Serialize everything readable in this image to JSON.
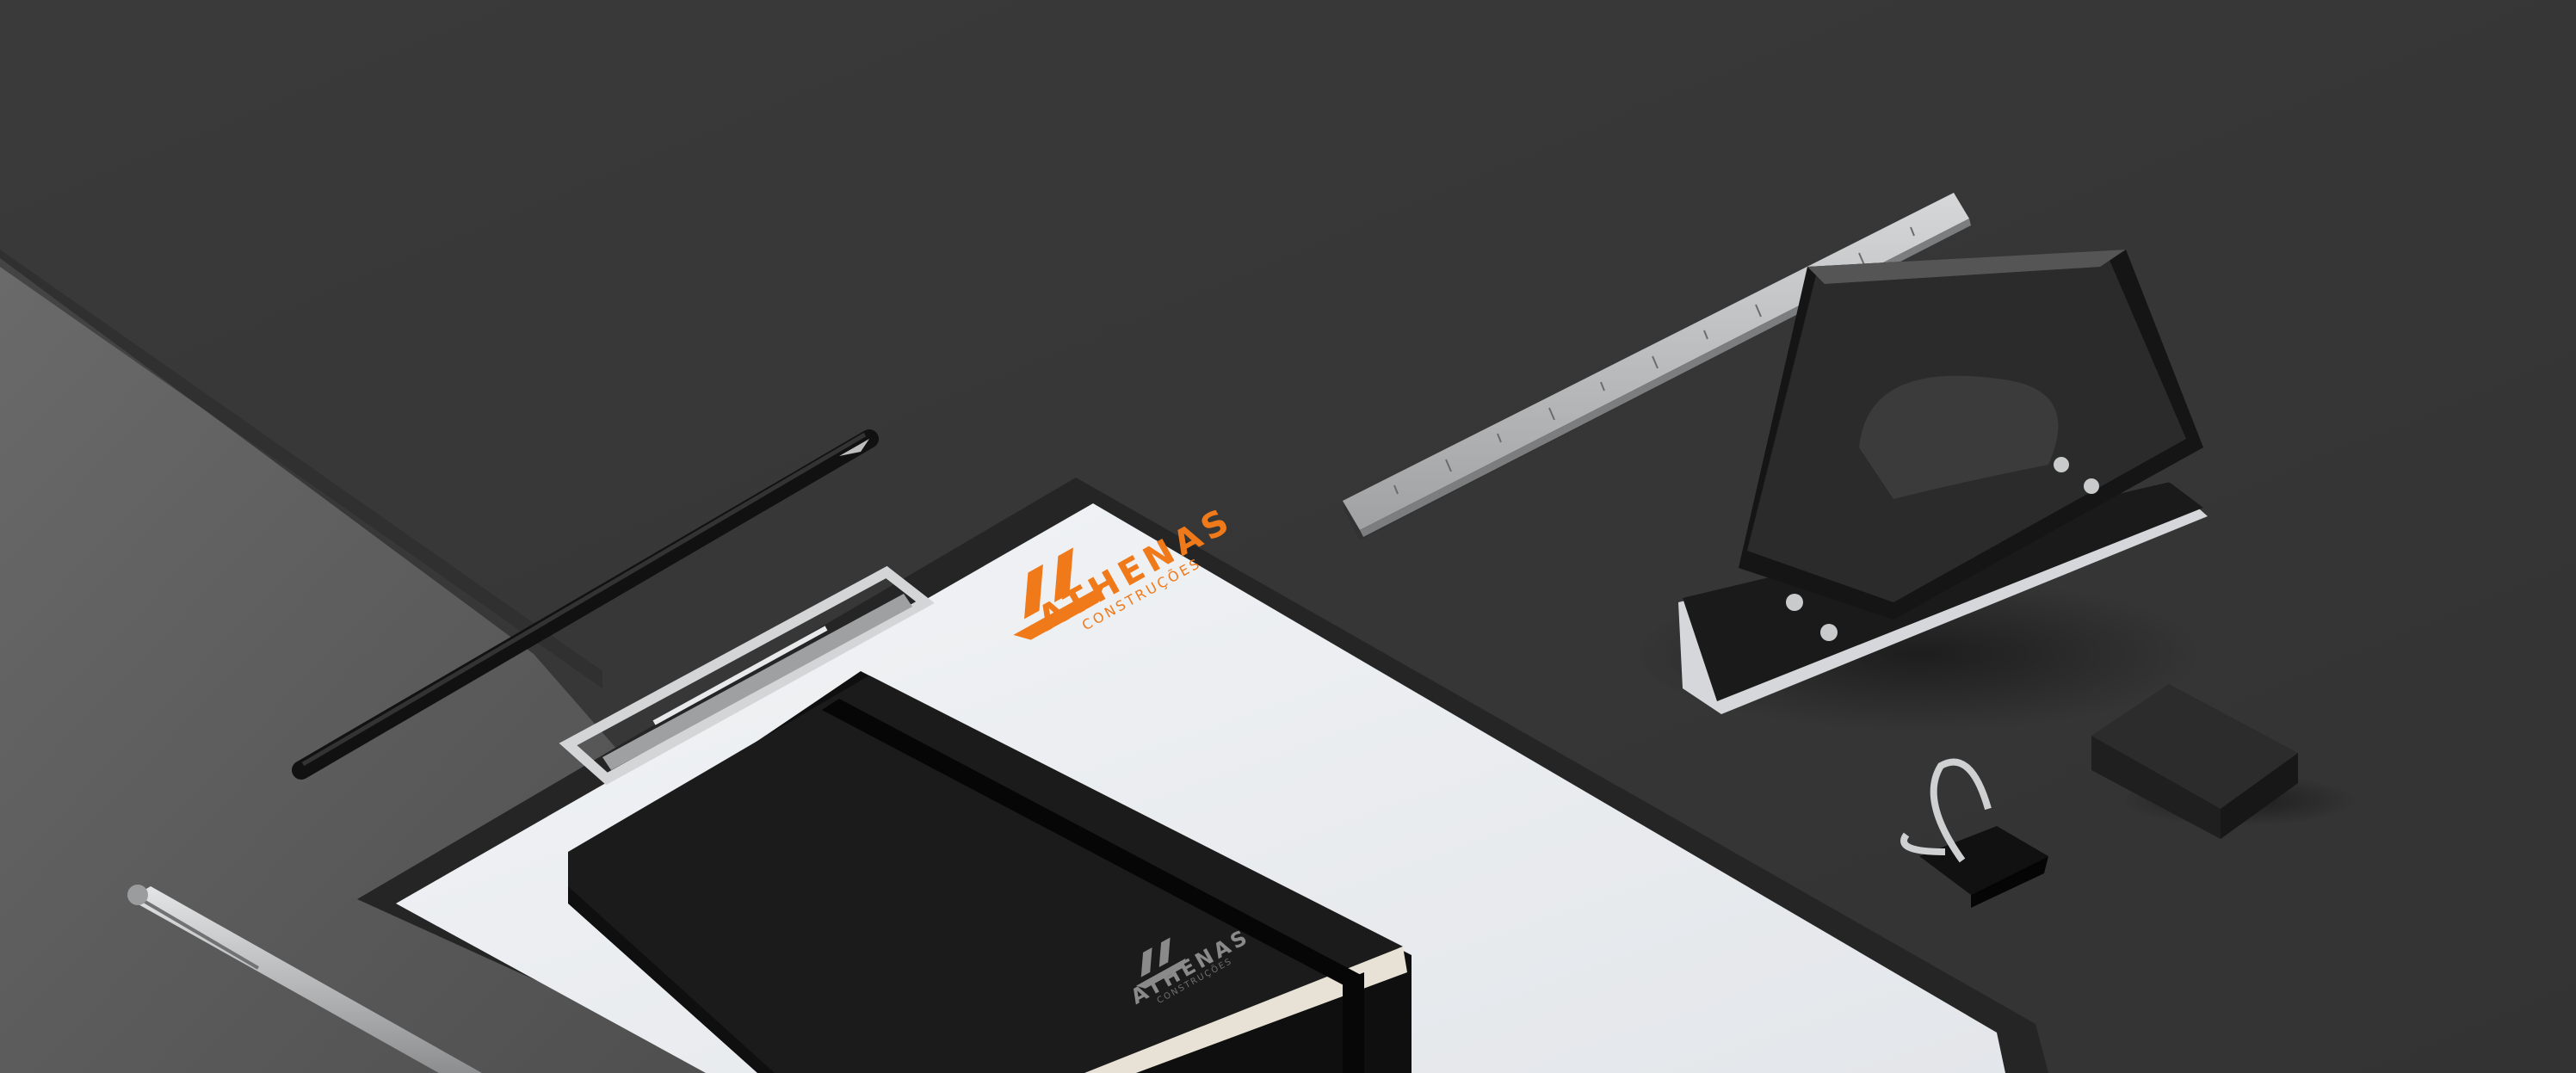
{
  "scene": {
    "description_tag": "stationery-mockup",
    "colors": {
      "desk": "#3b3b3b",
      "desk_light": "#5a5a5a",
      "paper": "#eef1f4",
      "clipboard": "#2a2a2a",
      "brand_orange": "#f07a1a",
      "notebook": "#161616",
      "metal": "#c9cacb"
    }
  },
  "brand": {
    "name": "ATHENAS",
    "tagline": "CONSTRUÇÕES",
    "notebook_name": "ATHENAS",
    "notebook_tagline": "CONSTRUÇÕES"
  }
}
